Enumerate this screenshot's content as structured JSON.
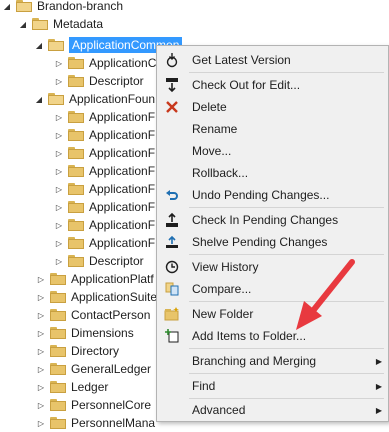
{
  "tree": {
    "branch": "Brandon-branch",
    "metadata": "Metadata",
    "app_common": "ApplicationCommon",
    "app_common_children": [
      "ApplicationC",
      "Descriptor"
    ],
    "app_foundation": "ApplicationFoun",
    "app_foundation_children": [
      "ApplicationF",
      "ApplicationF",
      "ApplicationF",
      "ApplicationF",
      "ApplicationF",
      "ApplicationF",
      "ApplicationF",
      "ApplicationF",
      "Descriptor"
    ],
    "folders": [
      "ApplicationPlatf",
      "ApplicationSuite",
      "ContactPerson",
      "Dimensions",
      "Directory",
      "GeneralLedger",
      "Ledger",
      "PersonnelCore",
      "PersonnelMana"
    ]
  },
  "menu": {
    "items": [
      {
        "label": "Get Latest Version",
        "icon": "get-latest-icon"
      },
      {
        "label": "Check Out for Edit...",
        "icon": "check-out-icon"
      },
      {
        "label": "Delete",
        "icon": "delete-icon"
      },
      {
        "label": "Rename",
        "icon": ""
      },
      {
        "label": "Move...",
        "icon": ""
      },
      {
        "label": "Rollback...",
        "icon": ""
      },
      {
        "label": "Undo Pending Changes...",
        "icon": "undo-icon"
      },
      {
        "label": "Check In Pending Changes",
        "icon": "check-in-icon"
      },
      {
        "label": "Shelve Pending Changes",
        "icon": "shelve-icon"
      },
      {
        "label": "View History",
        "icon": "history-icon"
      },
      {
        "label": "Compare...",
        "icon": "compare-icon"
      },
      {
        "label": "New Folder",
        "icon": "new-folder-icon"
      },
      {
        "label": "Add Items to Folder...",
        "icon": "add-items-icon"
      },
      {
        "label": "Branching and Merging",
        "icon": ""
      },
      {
        "label": "Find",
        "icon": ""
      },
      {
        "label": "Advanced",
        "icon": ""
      }
    ]
  },
  "colors": {
    "selection": "#3399ff",
    "annotation_arrow": "#e8393f"
  }
}
